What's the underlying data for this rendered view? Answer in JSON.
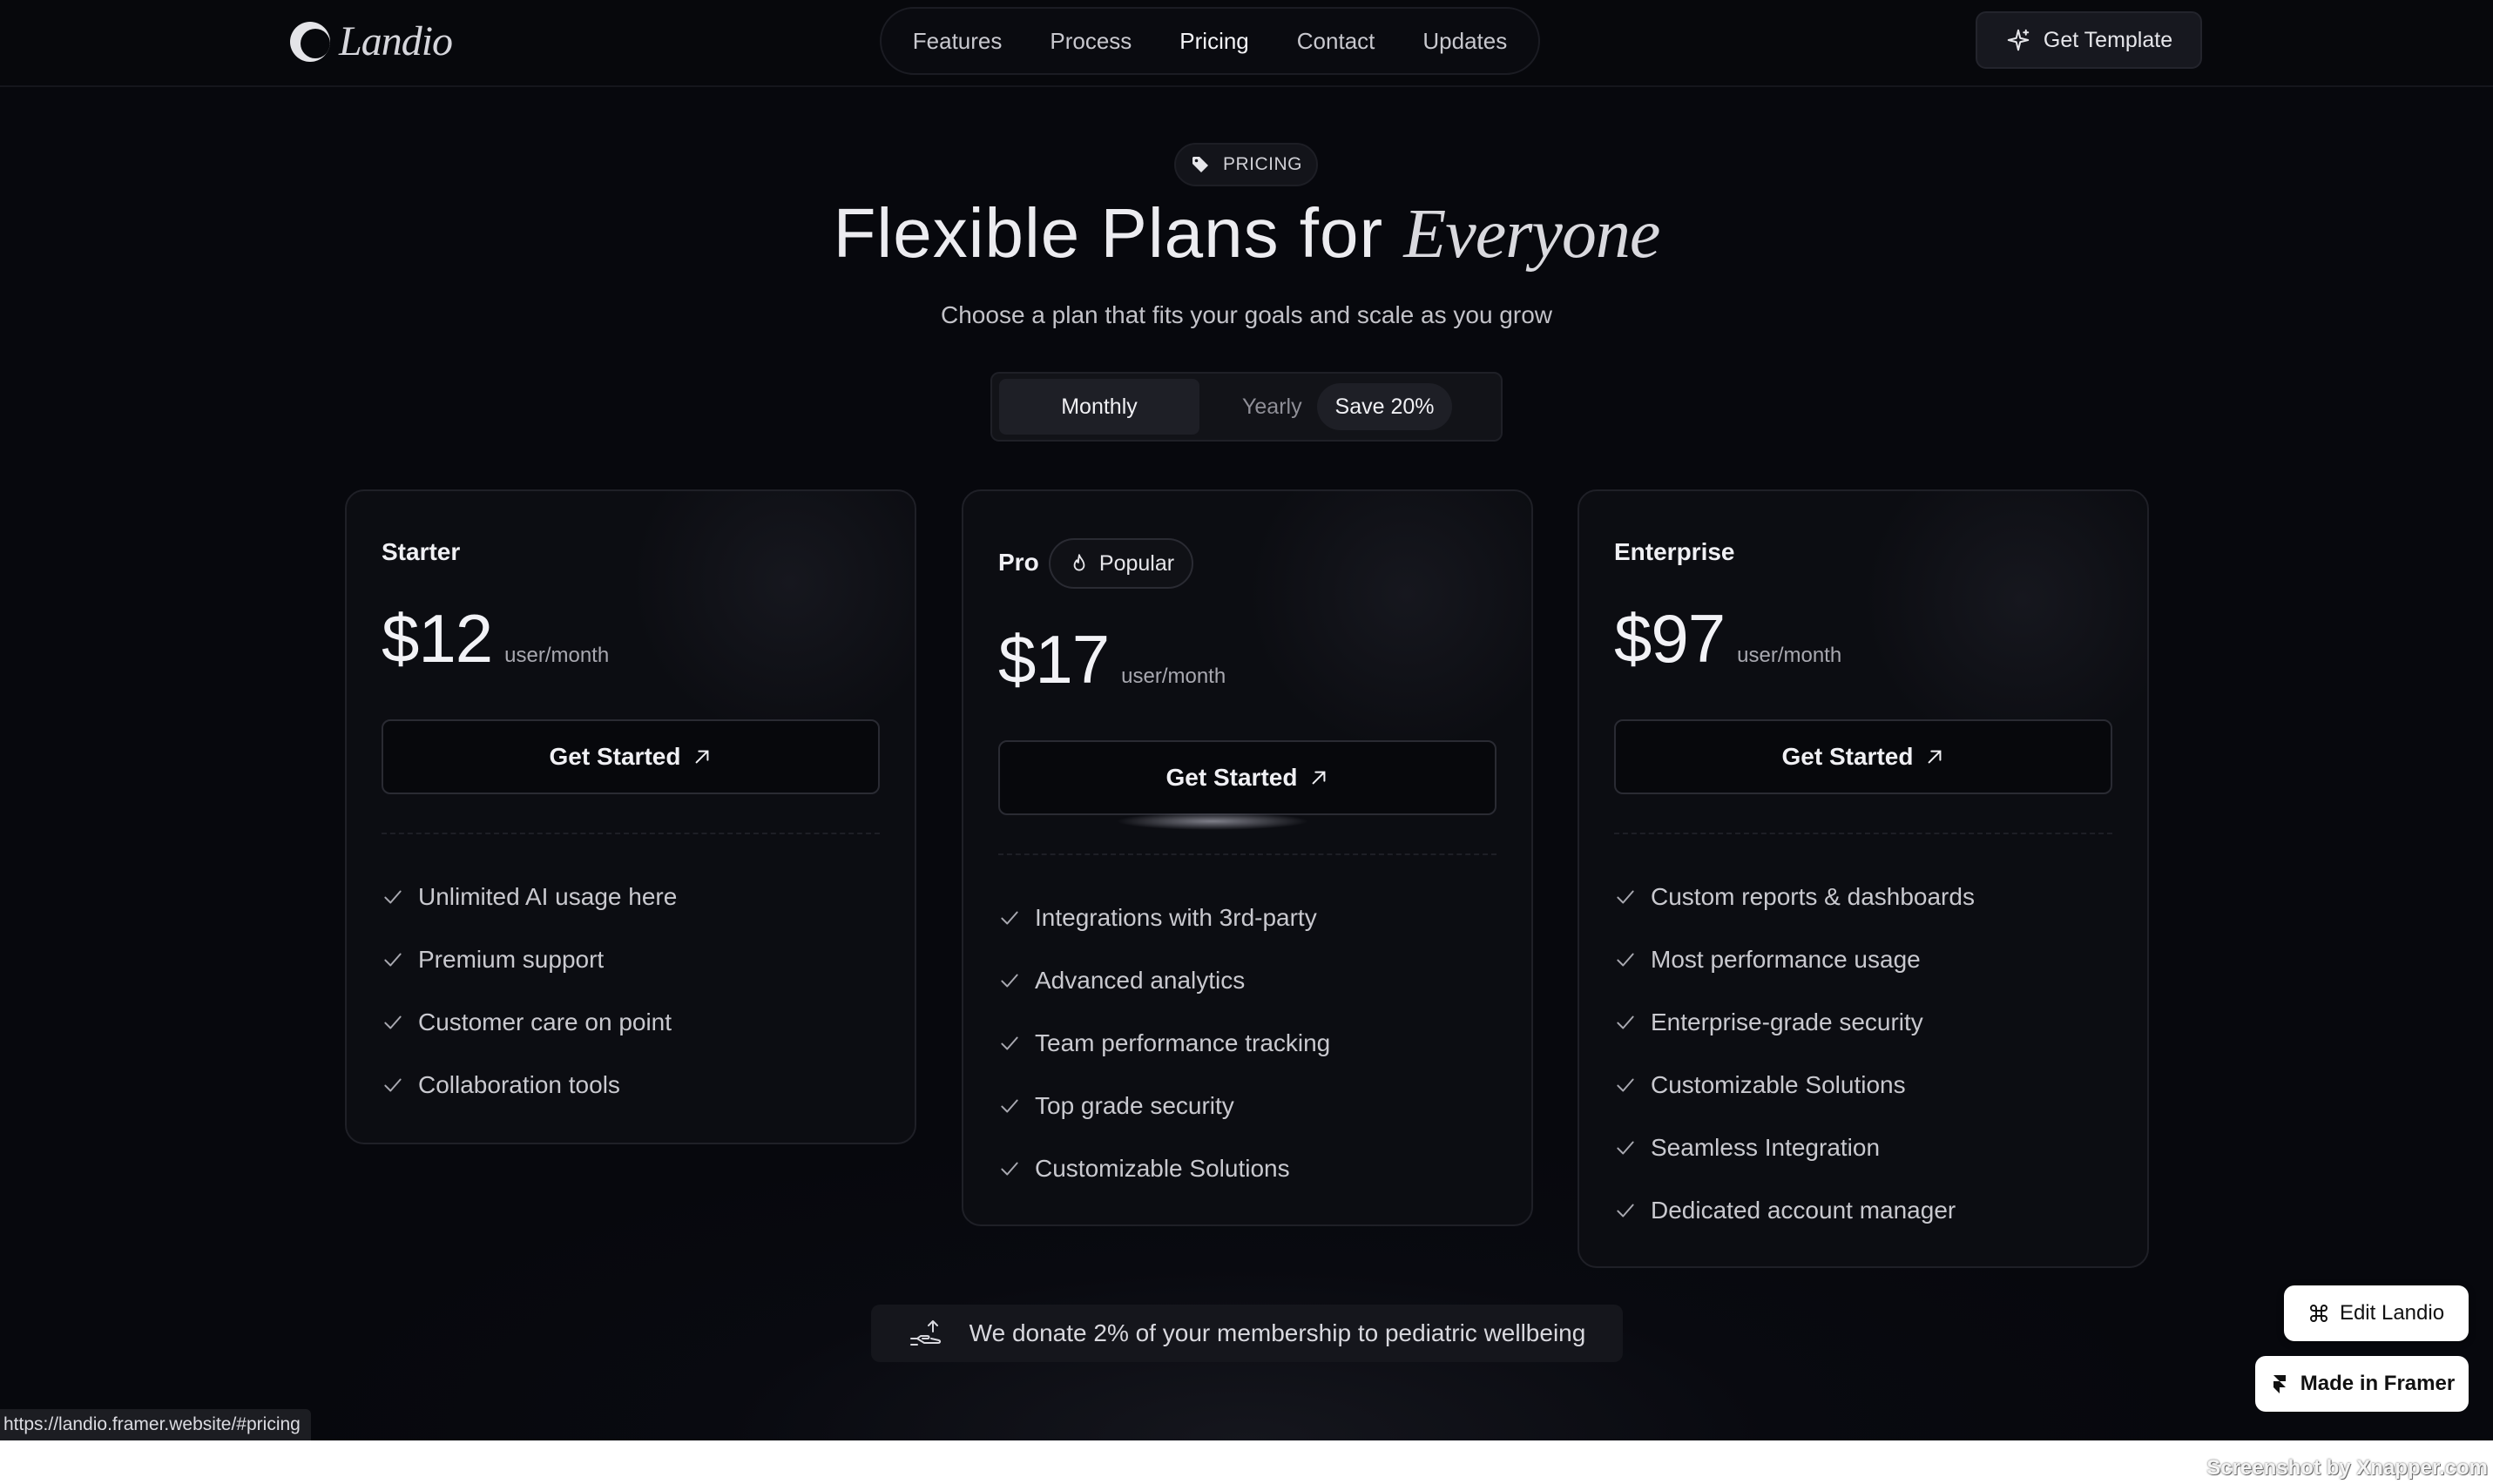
{
  "nav": {
    "logo_text": "Landio",
    "menu": [
      "Features",
      "Process",
      "Pricing",
      "Contact",
      "Updates"
    ],
    "active_menu": "Pricing",
    "cta_label": "Get Template"
  },
  "hero": {
    "badge": "PRICING",
    "title_main": "Flexible Plans for",
    "title_accent": "Everyone",
    "subtitle": "Choose a plan that fits your goals and scale as you grow"
  },
  "billing_toggle": {
    "monthly": "Monthly",
    "yearly": "Yearly",
    "save": "Save 20%",
    "selected": "Monthly"
  },
  "plans": [
    {
      "name": "Starter",
      "price": "$12",
      "unit": "user/month",
      "cta": "Get Started",
      "features": [
        "Unlimited AI usage here",
        "Premium support",
        "Customer care on point",
        "Collaboration tools"
      ]
    },
    {
      "name": "Pro",
      "badge": "Popular",
      "price": "$17",
      "unit": "user/month",
      "cta": "Get Started",
      "features": [
        "Integrations with 3rd-party",
        "Advanced analytics",
        "Team performance tracking",
        "Top grade security",
        "Customizable Solutions"
      ]
    },
    {
      "name": "Enterprise",
      "price": "$97",
      "unit": "user/month",
      "cta": "Get Started",
      "features": [
        "Custom reports & dashboards",
        "Most performance usage",
        "Enterprise-grade security",
        "Customizable Solutions",
        "Seamless Integration",
        "Dedicated account manager"
      ]
    }
  ],
  "donate_text": "We donate 2% of your membership to pediatric wellbeing",
  "floating": {
    "edit": "Edit Landio",
    "made": "Made in Framer"
  },
  "status_url": "https://landio.framer.website/#pricing",
  "watermark": "Screenshot by Xnapper.com",
  "colors": {
    "background": "#07080c",
    "card": "#0c0d12",
    "text": "#e8e8ec",
    "muted": "#a8a8b0"
  }
}
